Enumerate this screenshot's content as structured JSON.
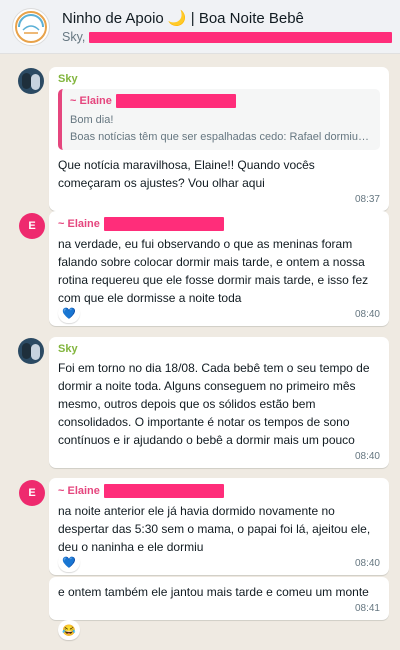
{
  "header": {
    "title": "Ninho de Apoio 🌙 | Boa Noite Bebê",
    "subtitle_prefix": "Sky,"
  },
  "messages": [
    {
      "sender": "Sky",
      "quote": {
        "author": "~ Elaine",
        "line1": "Bom dia!",
        "line2": "Boas notícias têm que ser espalhadas cedo: Rafael dormiu a noite toda"
      },
      "text": "Que notícia maravilhosa, Elaine!! Quando vocês começaram os ajustes? Vou olhar aqui",
      "time": "08:37"
    },
    {
      "sender": "~ Elaine",
      "avatar_letter": "E",
      "text": "na verdade, eu fui observando o que as meninas foram falando sobre colocar dormir mais tarde, e ontem a nossa rotina requereu que ele fosse dormir mais tarde, e isso fez com que ele dormisse a noite toda",
      "time": "08:40",
      "reaction": "💙"
    },
    {
      "sender": "Sky",
      "text": "Foi em torno no dia 18/08. Cada bebê tem o seu tempo de dormir a noite toda. Alguns conseguem no primeiro mês mesmo, outros depois que os sólidos estão bem consolidados. O importante é notar os tempos de sono contínuos e ir ajudando o bebê a dormir mais um pouco",
      "time": "08:40"
    },
    {
      "sender": "~ Elaine",
      "avatar_letter": "E",
      "text": "na noite anterior ele já havia dormido novamente no despertar das 5:30 sem o mama, o papai foi lá, ajeitou ele, deu o naninha e ele dormiu",
      "time": "08:40",
      "reaction": "💙"
    },
    {
      "text": "e ontem também ele jantou mais tarde e comeu um monte",
      "time": "08:41",
      "reaction": "😂"
    }
  ],
  "colors": {
    "background": "#efeae2",
    "header": "#f0f2f5",
    "sky_name": "#82b53d",
    "elaine_name": "#e5467e",
    "redaction": "#ff2d7a",
    "elaine_avatar": "#ee2a6e"
  },
  "icons": {
    "group_avatar": "group-logo-icon",
    "reaction_heart": "blue-heart-emoji",
    "reaction_laugh": "laughing-emoji"
  }
}
